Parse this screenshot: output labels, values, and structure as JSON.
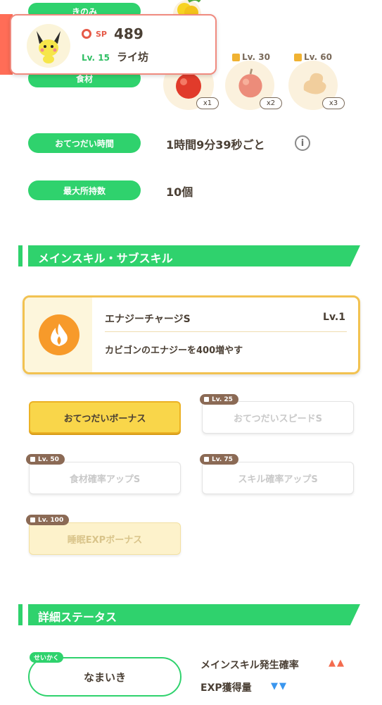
{
  "labels": {
    "kinomi": "きのみ",
    "shokuzai": "食材",
    "helper_time": "おてつだい時間",
    "max_carry": "最大所持数"
  },
  "header": {
    "sp_label": "SP",
    "sp_value": "489",
    "level": "Lv. 15",
    "name": "ライ坊"
  },
  "ingredients": [
    {
      "unlock": "",
      "qty": "x1",
      "name": "apple-icon"
    },
    {
      "unlock": "Lv. 30",
      "qty": "x2",
      "name": "apple-icon"
    },
    {
      "unlock": "Lv. 60",
      "qty": "x3",
      "name": "ginger-icon"
    }
  ],
  "helper_time_value": "1時間9分39秒ごと",
  "info_icon": "i",
  "max_carry_value": "10個",
  "sections": {
    "skills": "メインスキル・サブスキル",
    "details": "詳細ステータス"
  },
  "main_skill": {
    "name": "エナジーチャージS",
    "level": "Lv.1",
    "description": "カビゴンのエナジーを400増やす"
  },
  "sub_skills": [
    {
      "label": "おてつだいボーナス",
      "lock": ""
    },
    {
      "label": "おてつだいスピードS",
      "lock": "Lv. 25"
    },
    {
      "label": "食材確率アップS",
      "lock": "Lv. 50"
    },
    {
      "label": "スキル確率アップS",
      "lock": "Lv. 75"
    },
    {
      "label": "睡眠EXPボーナス",
      "lock": "Lv. 100"
    }
  ],
  "nature": {
    "tag": "せいかく",
    "value": "なまいき"
  },
  "stats": [
    {
      "label": "メインスキル発生確率",
      "arrows": "▲▲",
      "color": "#f36b4e"
    },
    {
      "label": "EXP獲得量",
      "arrows": "▼▼",
      "color": "#3a96ee"
    }
  ],
  "colors": {
    "accent_green": "#2fd26d",
    "accent_red": "#ff6d57",
    "skill_border": "#f2c251"
  }
}
